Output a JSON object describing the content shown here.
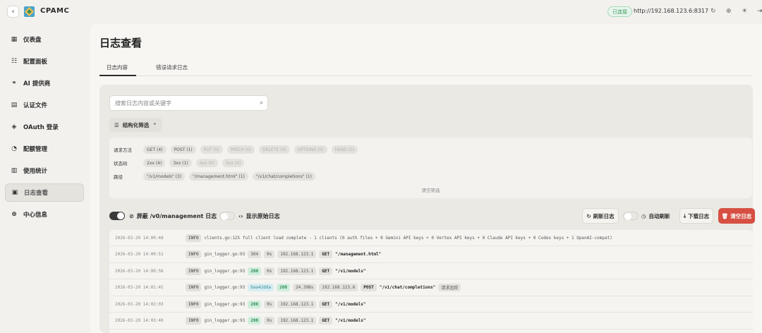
{
  "app": {
    "title": "CPAMC",
    "status_badge": "已连接",
    "server_url": "http://192.168.123.6:8317"
  },
  "sidebar": {
    "items": [
      {
        "label": "仪表盘",
        "icon": "dashboard-icon"
      },
      {
        "label": "配置面板",
        "icon": "sliders-icon"
      },
      {
        "label": "AI 提供商",
        "icon": "network-icon"
      },
      {
        "label": "认证文件",
        "icon": "file-icon"
      },
      {
        "label": "OAuth 登录",
        "icon": "shield-icon"
      },
      {
        "label": "配额管理",
        "icon": "pie-icon"
      },
      {
        "label": "使用统计",
        "icon": "bar-chart-icon"
      },
      {
        "label": "日志查看",
        "icon": "log-icon",
        "active": true
      },
      {
        "label": "中心信息",
        "icon": "globe-icon"
      }
    ]
  },
  "page": {
    "title": "日志查看",
    "tabs": [
      {
        "label": "日志内容",
        "active": true
      },
      {
        "label": "错误请求日志",
        "active": false
      }
    ]
  },
  "search": {
    "placeholder": "搜索日志内容或关键字"
  },
  "filters": {
    "toggle_label": "结构化筛选",
    "rows": [
      {
        "label": "请求方法",
        "chips": [
          {
            "text": "GET (4)",
            "enabled": true
          },
          {
            "text": "POST (1)",
            "enabled": true
          },
          {
            "text": "PUT (0)",
            "enabled": false
          },
          {
            "text": "PATCH (0)",
            "enabled": false
          },
          {
            "text": "DELETE (0)",
            "enabled": false
          },
          {
            "text": "OPTIONS (0)",
            "enabled": false
          },
          {
            "text": "HEAD (0)",
            "enabled": false
          }
        ]
      },
      {
        "label": "状态码",
        "chips": [
          {
            "text": "2xx (4)",
            "enabled": true
          },
          {
            "text": "3xx (1)",
            "enabled": true
          },
          {
            "text": "4xx (0)",
            "enabled": false
          },
          {
            "text": "5xx (0)",
            "enabled": false
          }
        ]
      },
      {
        "label": "路径",
        "chips": [
          {
            "text": "\"/v1/models\" (3)",
            "enabled": true
          },
          {
            "text": "\"/management.html\" (1)",
            "enabled": true
          },
          {
            "text": "\"/v1/chat/completions\" (1)",
            "enabled": true
          }
        ]
      }
    ],
    "clear_label": "清空筛选"
  },
  "controls": {
    "hide_mgmt_label": "屏蔽 /v0/management 日志",
    "hide_mgmt_on": true,
    "raw_label": "显示原始日志",
    "raw_on": false,
    "refresh_label": "刷新日志",
    "auto_refresh_label": "自动刷新",
    "auto_refresh_on": false,
    "download_label": "下载日志",
    "clear_label": "清空日志"
  },
  "logs": [
    {
      "time": "2026-03-20 14:00:48",
      "level": "INFO",
      "source": "clients.go:125",
      "message": "full client load complete - 1 clients (0 auth files + 0 Gemini API keys + 0 Vertex API keys + 0 Claude API keys + 0 Codex keys + 1 OpenAI-compat)"
    },
    {
      "time": "2026-03-20 14:00:51",
      "level": "INFO",
      "source": "gin_logger.go:93",
      "status": "304",
      "latency": "0s",
      "ip": "192.168.123.1",
      "method": "GET",
      "path": "\"/management.html\""
    },
    {
      "time": "2026-03-20 14:00:56",
      "level": "INFO",
      "source": "gin_logger.go:93",
      "status": "200",
      "latency": "0s",
      "ip": "192.168.123.1",
      "method": "GET",
      "path": "\"/v1/models\""
    },
    {
      "time": "2026-03-20 14:01:45",
      "level": "INFO",
      "source": "gin_logger.go:93",
      "request_id": "baa42dda",
      "status": "200",
      "latency": "24.398s",
      "ip": "192.168.123.6",
      "method": "POST",
      "path": "\"/v1/chat/completions\"",
      "note": "请求追踪"
    },
    {
      "time": "2026-03-20 14:02:03",
      "level": "INFO",
      "source": "gin_logger.go:93",
      "status": "200",
      "latency": "0s",
      "ip": "192.168.123.1",
      "method": "GET",
      "path": "\"/v1/models\""
    },
    {
      "time": "2026-03-20 14:03:40",
      "level": "INFO",
      "source": "gin_logger.go:93",
      "status": "200",
      "latency": "0s",
      "ip": "192.168.123.1",
      "method": "GET",
      "path": "\"/v1/models\""
    }
  ]
}
